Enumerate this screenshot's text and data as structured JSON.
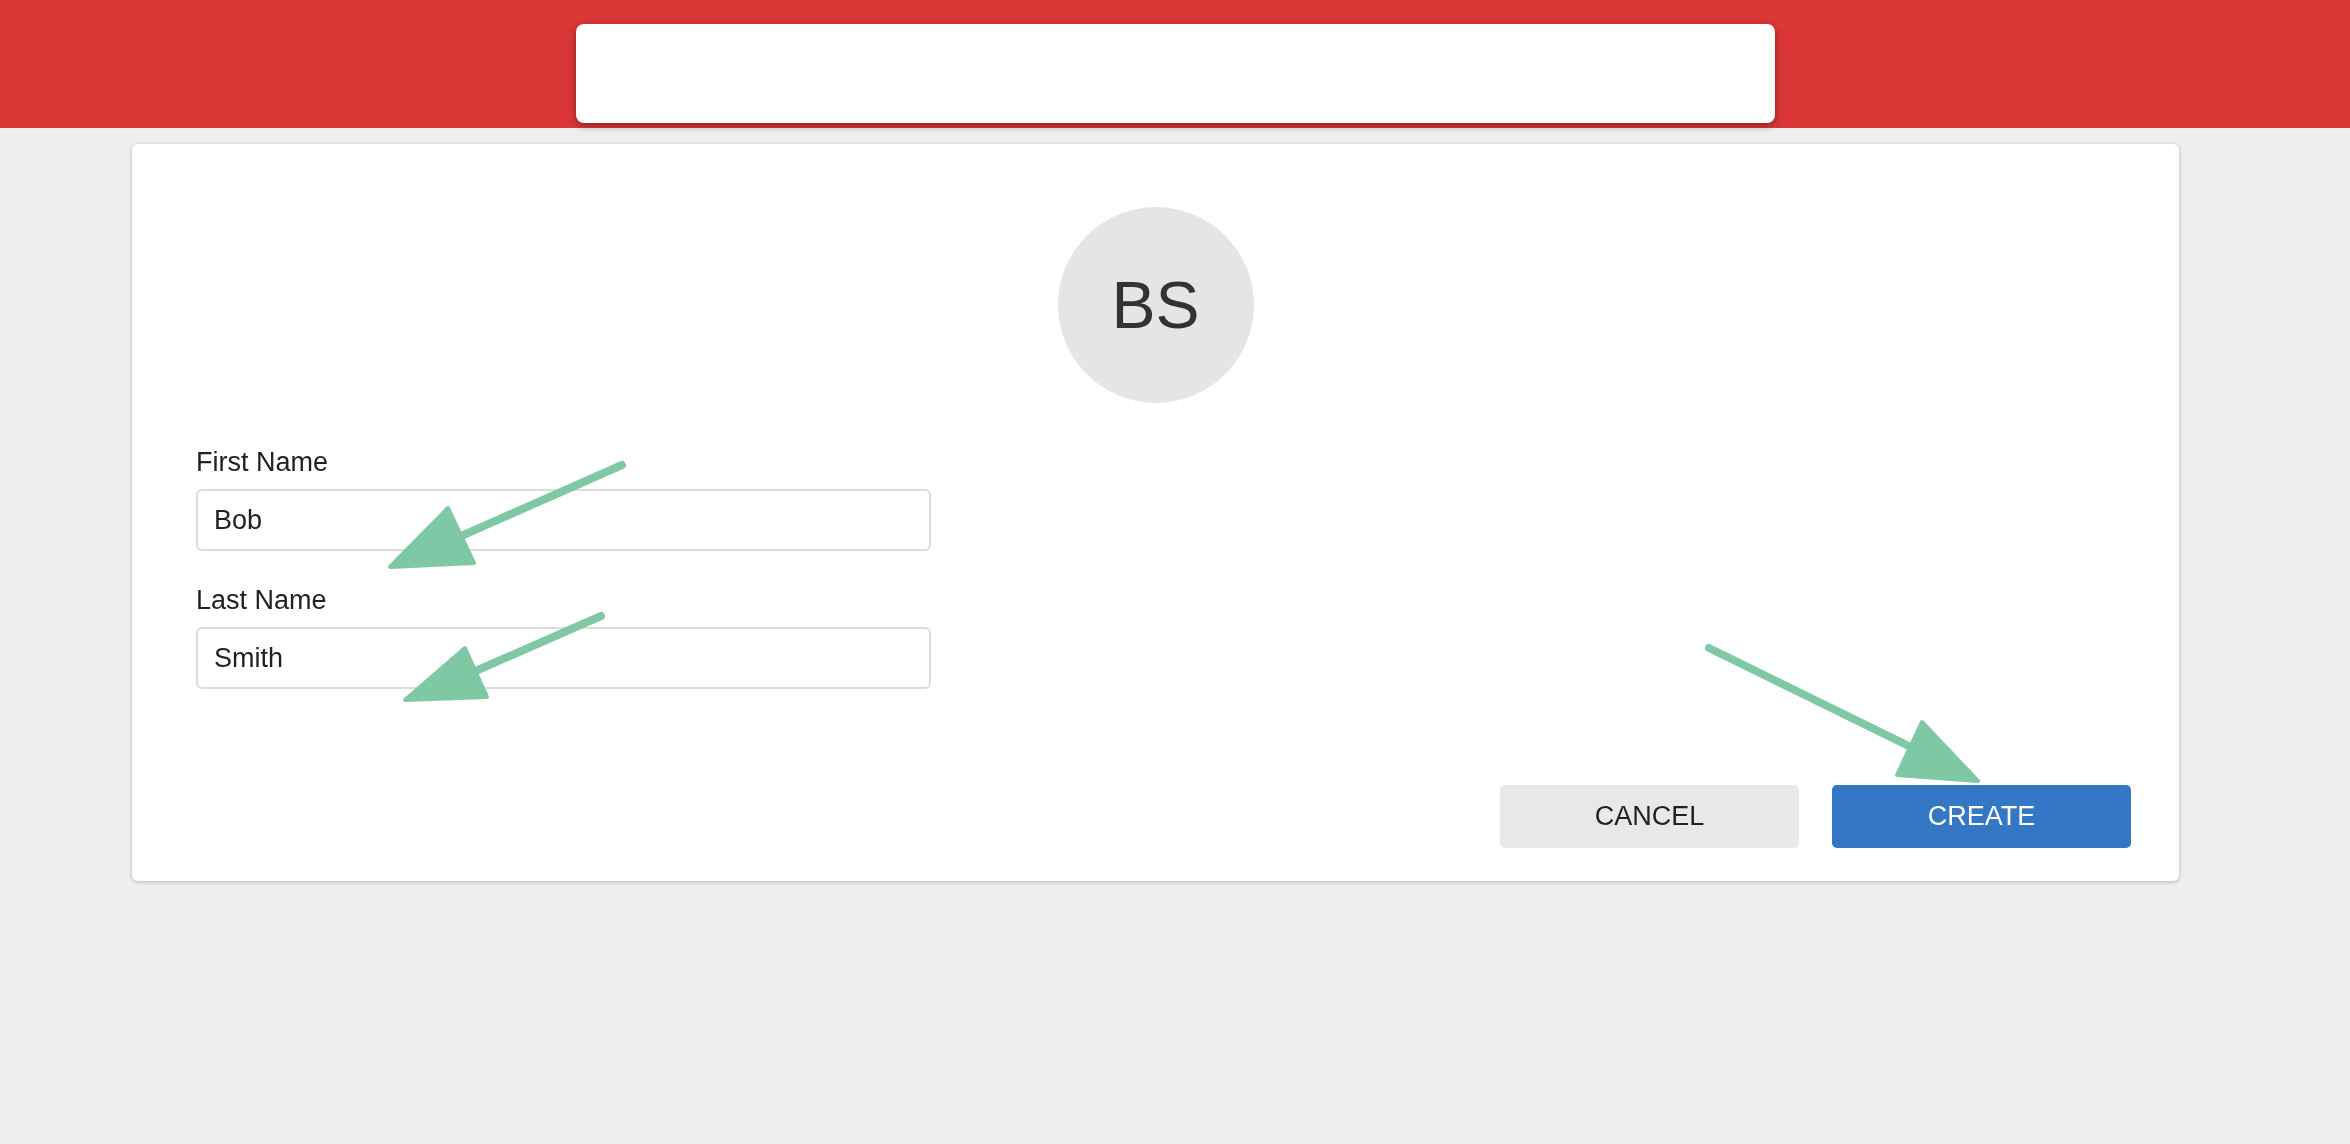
{
  "avatar": {
    "initials": "BS"
  },
  "fields": [
    {
      "label": "First Name",
      "value": "Bob"
    },
    {
      "label": "Last Name",
      "value": "Smith"
    }
  ],
  "buttons": [
    {
      "label": "CANCEL",
      "kind": "secondary"
    },
    {
      "label": "CREATE",
      "kind": "primary"
    }
  ]
}
